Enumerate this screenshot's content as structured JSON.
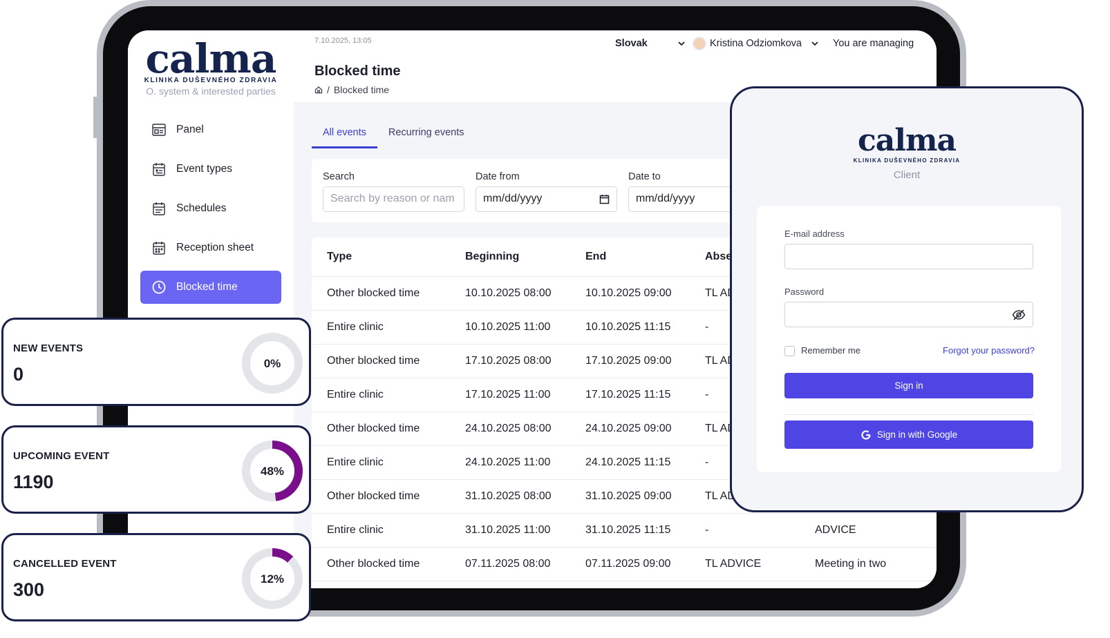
{
  "sidebar": {
    "logo": "calma",
    "logo_sub": "KLINIKA DUŠEVNÉHO ZDRAVIA",
    "tagline": "O. system & interested parties",
    "items": [
      {
        "label": "Panel",
        "icon": "panel-icon"
      },
      {
        "label": "Event types",
        "icon": "calendar-icon"
      },
      {
        "label": "Schedules",
        "icon": "schedule-icon"
      },
      {
        "label": "Reception sheet",
        "icon": "reception-icon"
      },
      {
        "label": "Blocked time",
        "icon": "clock-icon",
        "active": true
      }
    ]
  },
  "topbar": {
    "datetime": "7.10.2025, 13:05",
    "language": "Slovak",
    "user": "Kristina Odziomkova",
    "managing": "You are managing"
  },
  "header": {
    "title": "Blocked time",
    "breadcrumb": "Blocked time"
  },
  "tabs": [
    "All events",
    "Recurring events"
  ],
  "filters": {
    "search_label": "Search",
    "search_placeholder": "Search by reason or nam",
    "date_from_label": "Date from",
    "date_from_value": "mm/dd/yyyy",
    "date_to_label": "Date to",
    "date_to_value": "mm/dd/yyyy"
  },
  "table": {
    "columns": [
      "Type",
      "Beginning",
      "End",
      "Abser"
    ],
    "rows": [
      [
        "Other blocked time",
        "10.10.2025 08:00",
        "10.10.2025 09:00",
        "TL AD",
        ""
      ],
      [
        "Entire clinic",
        "10.10.2025 11:00",
        "10.10.2025 11:15",
        "-",
        ""
      ],
      [
        "Other blocked time",
        "17.10.2025 08:00",
        "17.10.2025 09:00",
        "TL AD",
        ""
      ],
      [
        "Entire clinic",
        "17.10.2025 11:00",
        "17.10.2025 11:15",
        "-",
        ""
      ],
      [
        "Other blocked time",
        "24.10.2025 08:00",
        "24.10.2025 09:00",
        "TL AD",
        ""
      ],
      [
        "Entire clinic",
        "24.10.2025 11:00",
        "24.10.2025 11:15",
        "-",
        ""
      ],
      [
        "Other blocked time",
        "31.10.2025 08:00",
        "31.10.2025 09:00",
        "TL AD",
        ""
      ],
      [
        "Entire clinic",
        "31.10.2025 11:00",
        "31.10.2025 11:15",
        "-",
        "ADVICE"
      ],
      [
        "Other blocked time",
        "07.11.2025 08:00",
        "07.11.2025 09:00",
        "TL ADVICE",
        "Meeting in two"
      ]
    ]
  },
  "stats": [
    {
      "label": "NEW EVENTS",
      "value": "0",
      "percent_label": "0%",
      "percent": 0,
      "color": "#7a0f8c"
    },
    {
      "label": "UPCOMING EVENT",
      "value": "1190",
      "percent_label": "48%",
      "percent": 48,
      "color": "#7a0f8c"
    },
    {
      "label": "CANCELLED EVENT",
      "value": "300",
      "percent_label": "12%",
      "percent": 12,
      "color": "#7a0f8c"
    }
  ],
  "login": {
    "logo": "calma",
    "logo_sub": "KLINIKA DUŠEVNÉHO ZDRAVIA",
    "subtitle": "Client",
    "email_label": "E-mail address",
    "password_label": "Password",
    "remember_label": "Remember me",
    "forgot_label": "Forgot your password?",
    "signin_label": "Sign in",
    "google_label": "Sign in with Google"
  },
  "colors": {
    "accent": "#6a65f3",
    "primary_button": "#4f45e4",
    "donut": "#7a0f8c",
    "navy": "#15234d"
  }
}
